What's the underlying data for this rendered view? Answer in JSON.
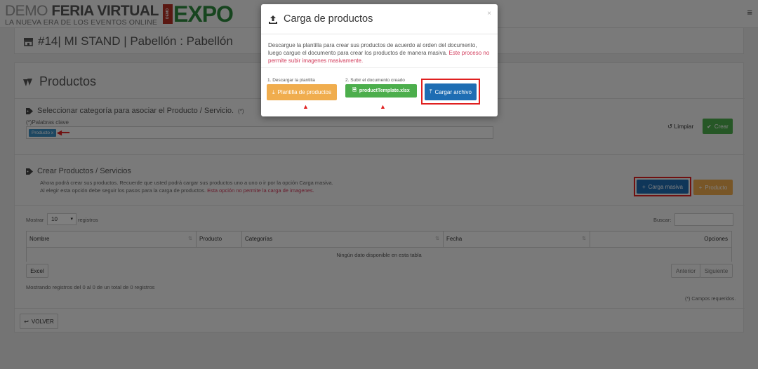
{
  "colors": {
    "accent_blue": "#1e6db3",
    "green": "#4cae4c",
    "orange": "#f0ad4e",
    "highlight_red": "#e02020",
    "warning_text": "#d23b5b",
    "brand_green": "#2f8a3e"
  },
  "header": {
    "brand_prefix": "DEMO",
    "brand_name": "FERIA VIRTUAL",
    "brand_tagline": "LA NUEVA ERA DE LOS EVENTOS ONLINE",
    "expo_badge": "DEMO",
    "expo_text": "EXPO",
    "menu_icon": "≡"
  },
  "stand": {
    "icon": "store-icon",
    "title": "#14| MI STAND | Pabellón : Pabellón"
  },
  "products": {
    "title": "Productos",
    "category_section": {
      "label": "Seleccionar categoría para asociar el Producto / Servicio.",
      "required_mark": "(*)",
      "keywords_label": "(*)Palabras clave",
      "tag": "Producto",
      "tag_remove": "x",
      "clear_label": "Limpiar",
      "create_label": "Crear"
    },
    "create_section": {
      "label": "Crear Productos / Servicios",
      "desc_line1": "Ahora podrá crear sus productos. Recuerde que usted podrá cargar sus productos uno a uno o ir por la opción Carga masiva.",
      "desc_line2_prefix": "Al elegir esta opción debe seguir los pasos para la carga de productos.",
      "desc_line2_warning": "Esta opción no permite la carga de imagenes.",
      "bulk_label": "Carga masiva",
      "product_label": "Producto"
    },
    "table": {
      "show_prefix": "Mostrar",
      "page_size": "10",
      "show_suffix": "registros",
      "search_label": "Buscar:",
      "columns": [
        "Nombre",
        "Producto",
        "Categorías",
        "Fecha",
        "Opciones"
      ],
      "empty": "Ningún dato disponible en esta tabla",
      "excel_label": "Excel",
      "prev_label": "Anterior",
      "next_label": "Siguiente",
      "summary": "Mostrando registros del 0 al 0 de un total de 0 registros",
      "required_note": "(*) Campos requeridos."
    },
    "back_label": "VOLVER"
  },
  "modal": {
    "title": "Carga de productos",
    "close": "×",
    "body": "Descargue la plantilla para crear sus productos de acuerdo al orden del documento, luego cargue el documento para crear los productos de manera masiva.",
    "body_warning": "Este proceso no permite subir imagenes masivamente.",
    "step1_label": "1. Descargar la plantilla",
    "step1_button": "Plantilla de productos",
    "step2_label": "2. Subir el documento creado",
    "step2_file": "productTemplate.xlsx",
    "upload_button": "Cargar archivo"
  }
}
